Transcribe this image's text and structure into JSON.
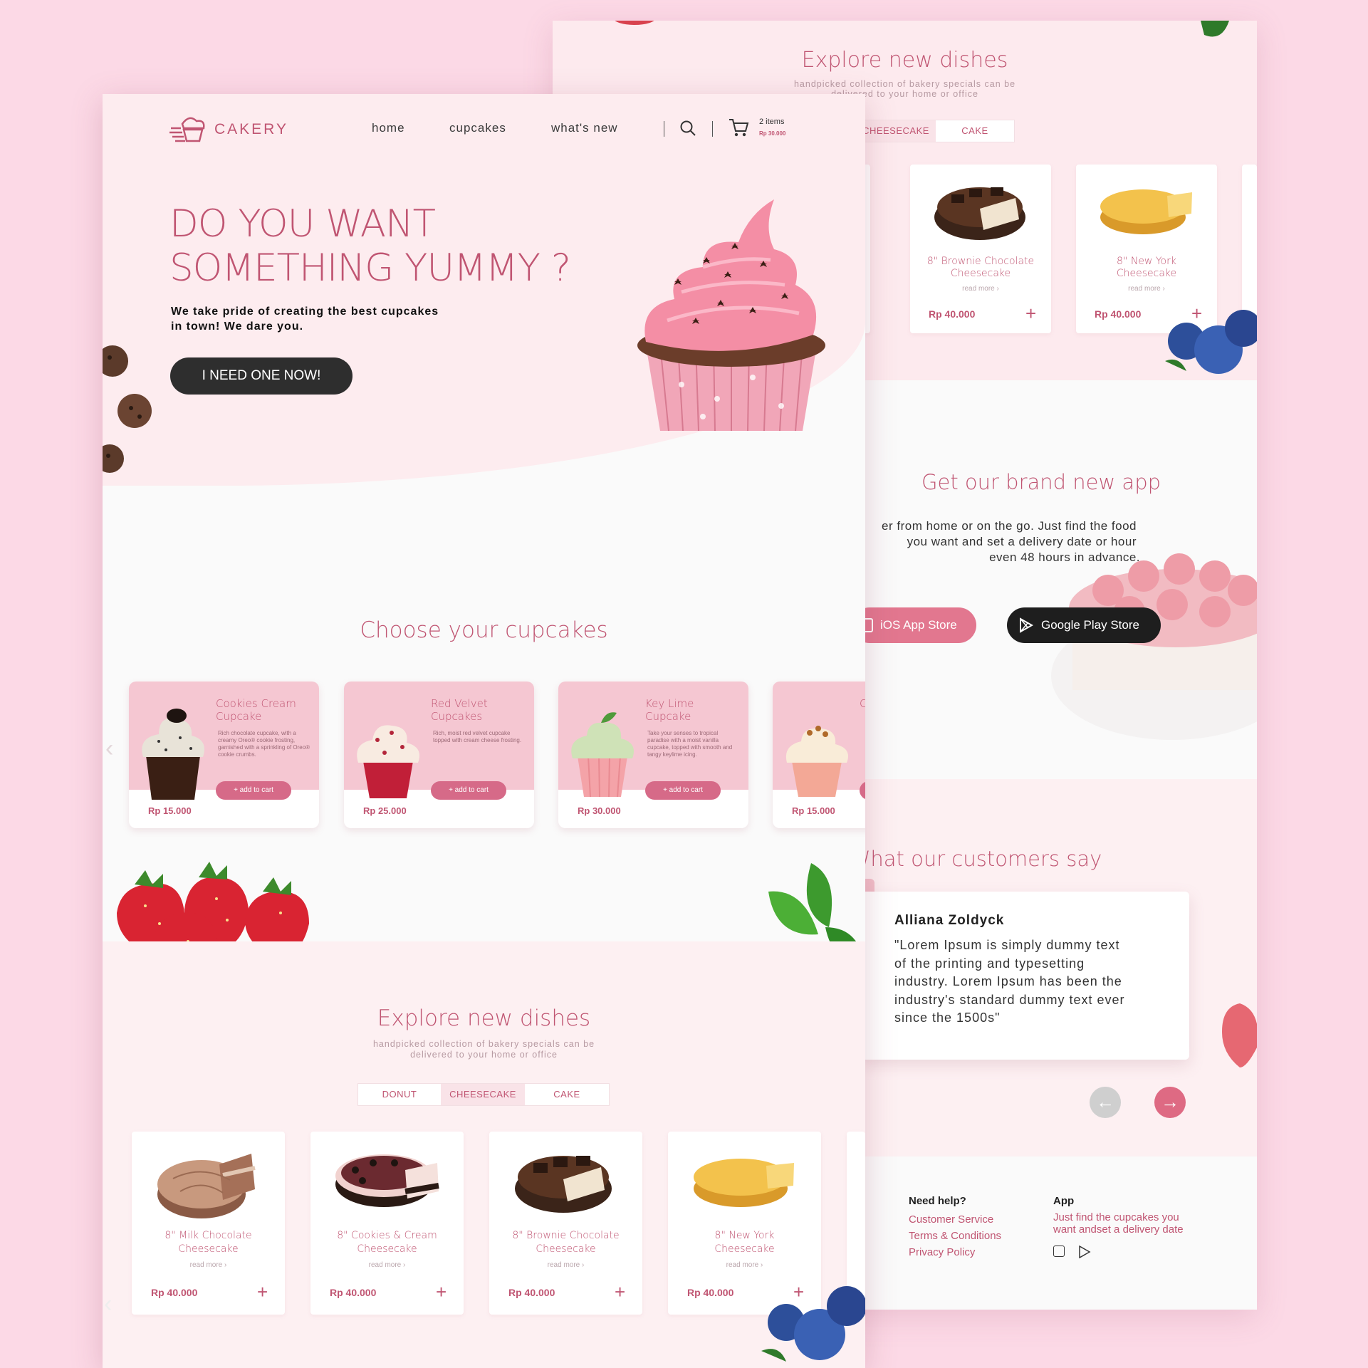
{
  "brand": {
    "name": "CAKERY"
  },
  "nav": {
    "items": [
      "home",
      "cupcakes",
      "what's new"
    ],
    "cart_count": "2 items",
    "cart_total": "Rp 30.000"
  },
  "hero": {
    "title_line1": "DO YOU WANT",
    "title_line2": "SOMETHING YUMMY ?",
    "tagline_line1": "We take pride of creating the best cupcakes",
    "tagline_line2": "in town! We dare you.",
    "cta": "I NEED ONE NOW!"
  },
  "cupcakes": {
    "title": "Choose your cupcakes",
    "add_label": "+ add to cart",
    "items": [
      {
        "name": "Cookies Cream Cupcake",
        "desc": "Rich chocolate cupcake, with a creamy Oreo® cookie frosting, garnished with a sprinkling of Oreo® cookie crumbs.",
        "price": "Rp 15.000"
      },
      {
        "name": "Red Velvet Cupcakes",
        "desc": "Rich, moist red velvet cupcake topped with cream cheese frosting.",
        "price": "Rp 25.000"
      },
      {
        "name": "Key Lime Cupcake",
        "desc": "Take your senses to tropical paradise with a moist vanilla cupcake, topped with smooth and tangy keylime icing.",
        "price": "Rp 30.000"
      },
      {
        "name": "C",
        "desc": "",
        "price": "Rp 15.000"
      }
    ]
  },
  "explore": {
    "title": "Explore new dishes",
    "subtitle_line1": "handpicked collection of bakery specials can be",
    "subtitle_line2": "delivered to your home or office",
    "tabs": [
      "DONUT",
      "CHEESECAKE",
      "CAKE"
    ],
    "active_tab": "CHEESECAKE",
    "read_more": "read more ›",
    "dishes": [
      {
        "name_line1": "8\" Milk Chocolate",
        "name_line2": "Cheesecake",
        "price": "Rp 40.000"
      },
      {
        "name_line1": "8\" Cookies & Cream",
        "name_line2": "Cheesecake",
        "price": "Rp 40.000"
      },
      {
        "name_line1": "8\" Brownie Chocolate",
        "name_line2": "Cheesecake",
        "price": "Rp 40.000"
      },
      {
        "name_line1": "8\" New York",
        "name_line2": "Cheesecake",
        "price": "Rp 40.000"
      }
    ]
  },
  "app": {
    "title": "Get  our brand new app",
    "text_line1": "er from home or on  the go. Just find the food",
    "text_line2": "you want and set a delivery date or hour",
    "text_line3": "even 48 hours in advance.",
    "ios": "iOS App Store",
    "google": "Google Play Store"
  },
  "testimonials": {
    "title": "What our customers say",
    "name": "Alliana Zoldyck",
    "quote_lines": [
      "\"Lorem Ipsum is simply dummy text",
      "of the printing and typesetting",
      "industry. Lorem Ipsum has been the",
      "industry's standard dummy text ever",
      "since the 1500s\""
    ]
  },
  "footer": {
    "help_title": "Need help?",
    "help_links": [
      "Customer Service",
      "Terms & Conditions",
      "Privacy Policy"
    ],
    "app_title": "App",
    "app_text_line1": "Just find the cupcakes you",
    "app_text_line2": "want andset a delivery date"
  },
  "colors": {
    "page_bg": "#fcd9e6",
    "accent": "#c05572",
    "button_dark": "#2e2e2e",
    "card_pink": "#f5c7d2",
    "cart_button": "#d66a88"
  }
}
